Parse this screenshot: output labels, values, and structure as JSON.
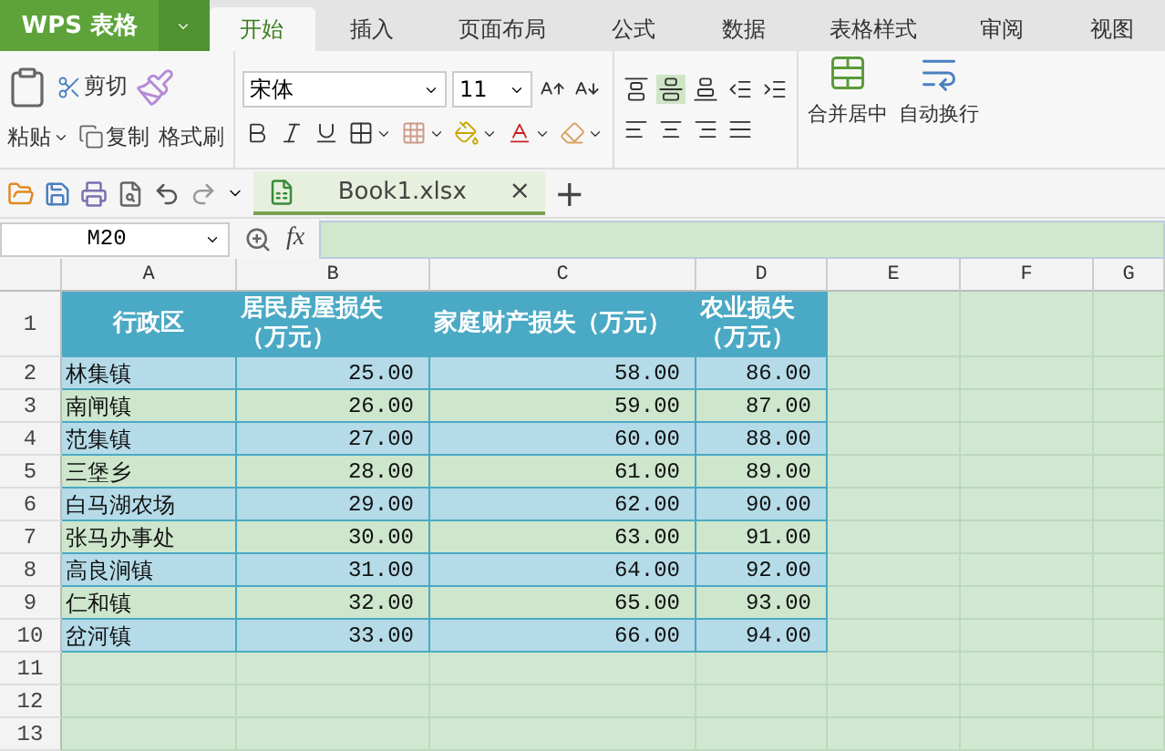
{
  "app": {
    "logo": "WPS 表格",
    "tabs": [
      {
        "label": "开始",
        "selected": true
      },
      {
        "label": "插入",
        "selected": false
      },
      {
        "label": "页面布局",
        "selected": false
      },
      {
        "label": "公式",
        "selected": false
      },
      {
        "label": "数据",
        "selected": false
      },
      {
        "label": "表格样式",
        "selected": false
      },
      {
        "label": "审阅",
        "selected": false
      },
      {
        "label": "视图",
        "selected": false
      }
    ]
  },
  "ribbon": {
    "paste": "粘贴",
    "cut": "剪切",
    "copy": "复制",
    "format_painter": "格式刷",
    "font_name": "宋体",
    "font_size": "11",
    "vertical_align": [
      {
        "kind": "top",
        "selected": false
      },
      {
        "kind": "middle",
        "selected": true
      },
      {
        "kind": "bottom",
        "selected": false
      }
    ],
    "merge": "合并居中",
    "wrap": "自动换行"
  },
  "document_tab": {
    "name": "Book1.xlsx",
    "close": "×",
    "add": "+"
  },
  "formula_bar": {
    "cell_ref": "M20",
    "fx": "fx"
  },
  "sheet": {
    "columns": [
      "A",
      "B",
      "C",
      "D",
      "E",
      "F",
      "G"
    ],
    "rows": [
      {
        "number": "1",
        "kind": "header",
        "cells": [
          "行政区",
          "居民房屋损失（万元）",
          "家庭财产损失（万元）",
          "农业损失（万元）"
        ]
      },
      {
        "number": "2",
        "kind": "blue",
        "cells": [
          "林集镇",
          "25.00",
          "58.00",
          "86.00"
        ]
      },
      {
        "number": "3",
        "kind": "green",
        "cells": [
          "南闸镇",
          "26.00",
          "59.00",
          "87.00"
        ]
      },
      {
        "number": "4",
        "kind": "blue",
        "cells": [
          "范集镇",
          "27.00",
          "60.00",
          "88.00"
        ]
      },
      {
        "number": "5",
        "kind": "green",
        "cells": [
          "三堡乡",
          "28.00",
          "61.00",
          "89.00"
        ]
      },
      {
        "number": "6",
        "kind": "blue",
        "cells": [
          "白马湖农场",
          "29.00",
          "62.00",
          "90.00"
        ]
      },
      {
        "number": "7",
        "kind": "green",
        "cells": [
          "张马办事处",
          "30.00",
          "63.00",
          "91.00"
        ]
      },
      {
        "number": "8",
        "kind": "blue",
        "cells": [
          "高良涧镇",
          "31.00",
          "64.00",
          "92.00"
        ]
      },
      {
        "number": "9",
        "kind": "green",
        "cells": [
          "仁和镇",
          "32.00",
          "65.00",
          "93.00"
        ]
      },
      {
        "number": "10",
        "kind": "blue",
        "cells": [
          "岔河镇",
          "33.00",
          "66.00",
          "94.00"
        ]
      },
      {
        "number": "11",
        "kind": "empty",
        "cells": []
      },
      {
        "number": "12",
        "kind": "empty",
        "cells": []
      },
      {
        "number": "13",
        "kind": "empty",
        "cells": []
      }
    ]
  }
}
